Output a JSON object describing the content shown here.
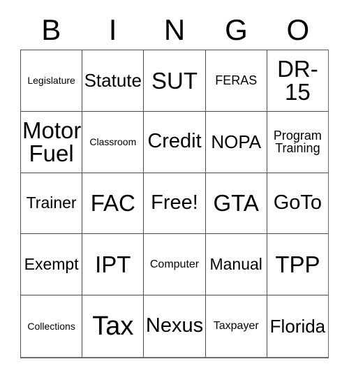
{
  "card": {
    "header_letters": [
      "B",
      "I",
      "N",
      "G",
      "O"
    ],
    "free_space_label": "Free!",
    "grid": [
      [
        {
          "label": "Legislature",
          "size": "xs"
        },
        {
          "label": "Statute",
          "size": "ml"
        },
        {
          "label": "SUT",
          "size": "xl"
        },
        {
          "label": "FERAS",
          "size": "sm"
        },
        {
          "label": "DR-\n15",
          "size": "xl"
        }
      ],
      [
        {
          "label": "Motor\nFuel",
          "size": "xl"
        },
        {
          "label": "Classroom",
          "size": "xs"
        },
        {
          "label": "Credit",
          "size": "l"
        },
        {
          "label": "NOPA",
          "size": "ml"
        },
        {
          "label": "Program\nTraining",
          "size": "sm"
        }
      ],
      [
        {
          "label": "Trainer",
          "size": "m"
        },
        {
          "label": "FAC",
          "size": "xl"
        },
        {
          "label": "Free!",
          "size": "l"
        },
        {
          "label": "GTA",
          "size": "xl"
        },
        {
          "label": "GoTo",
          "size": "l"
        }
      ],
      [
        {
          "label": "Exempt",
          "size": "m"
        },
        {
          "label": "IPT",
          "size": "xl"
        },
        {
          "label": "Computer",
          "size": "s"
        },
        {
          "label": "Manual",
          "size": "m"
        },
        {
          "label": "TPP",
          "size": "xl"
        }
      ],
      [
        {
          "label": "Collections",
          "size": "xs"
        },
        {
          "label": "Tax",
          "size": "xxl"
        },
        {
          "label": "Nexus",
          "size": "l"
        },
        {
          "label": "Taxpayer",
          "size": "s"
        },
        {
          "label": "Florida",
          "size": "ml"
        }
      ]
    ]
  },
  "colors": {
    "background": "#ffffff",
    "text": "#000000",
    "grid_line": "#4a4a4a"
  }
}
